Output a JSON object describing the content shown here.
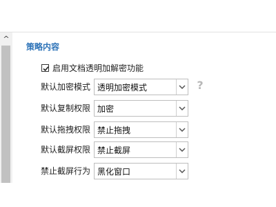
{
  "section": {
    "title": "策略内容"
  },
  "checkbox": {
    "label": "启用文档透明加解密功能",
    "checked": true
  },
  "fields": [
    {
      "label": "默认加密模式",
      "value": "透明加密模式"
    },
    {
      "label": "默认复制权限",
      "value": "加密"
    },
    {
      "label": "默认拖拽权限",
      "value": "禁止拖拽"
    },
    {
      "label": "默认截屏权限",
      "value": "禁止截屏"
    },
    {
      "label": "禁止截屏行为",
      "value": "黑化窗口"
    }
  ],
  "icons": {
    "help": "?",
    "scroll_up": "^"
  },
  "colors": {
    "section_title": "#2d73b8",
    "help_icon": "#b8b8b8"
  }
}
